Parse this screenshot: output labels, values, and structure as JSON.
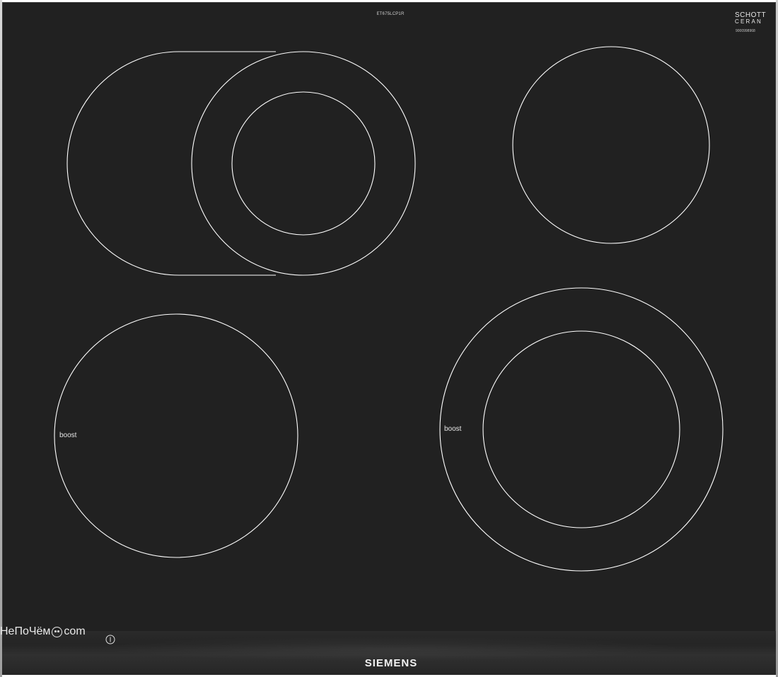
{
  "product": {
    "model_code": "ET675LCP1R",
    "brand": "SIEMENS",
    "glass_brand_line1": "SCHOTT",
    "glass_brand_line2": "CERAN",
    "serial": "9000998968"
  },
  "zones": [
    {
      "id": "front-left",
      "label": "boost"
    },
    {
      "id": "rear-right",
      "label": ""
    },
    {
      "id": "rear-left",
      "label": ""
    },
    {
      "id": "front-right",
      "label": "boost"
    }
  ],
  "watermark": {
    "prefix": "НеПоЧём",
    "suffix": "com"
  },
  "colors": {
    "glass": "#212121",
    "lines": "#ffffff"
  },
  "icons": {
    "power": "power-icon"
  }
}
